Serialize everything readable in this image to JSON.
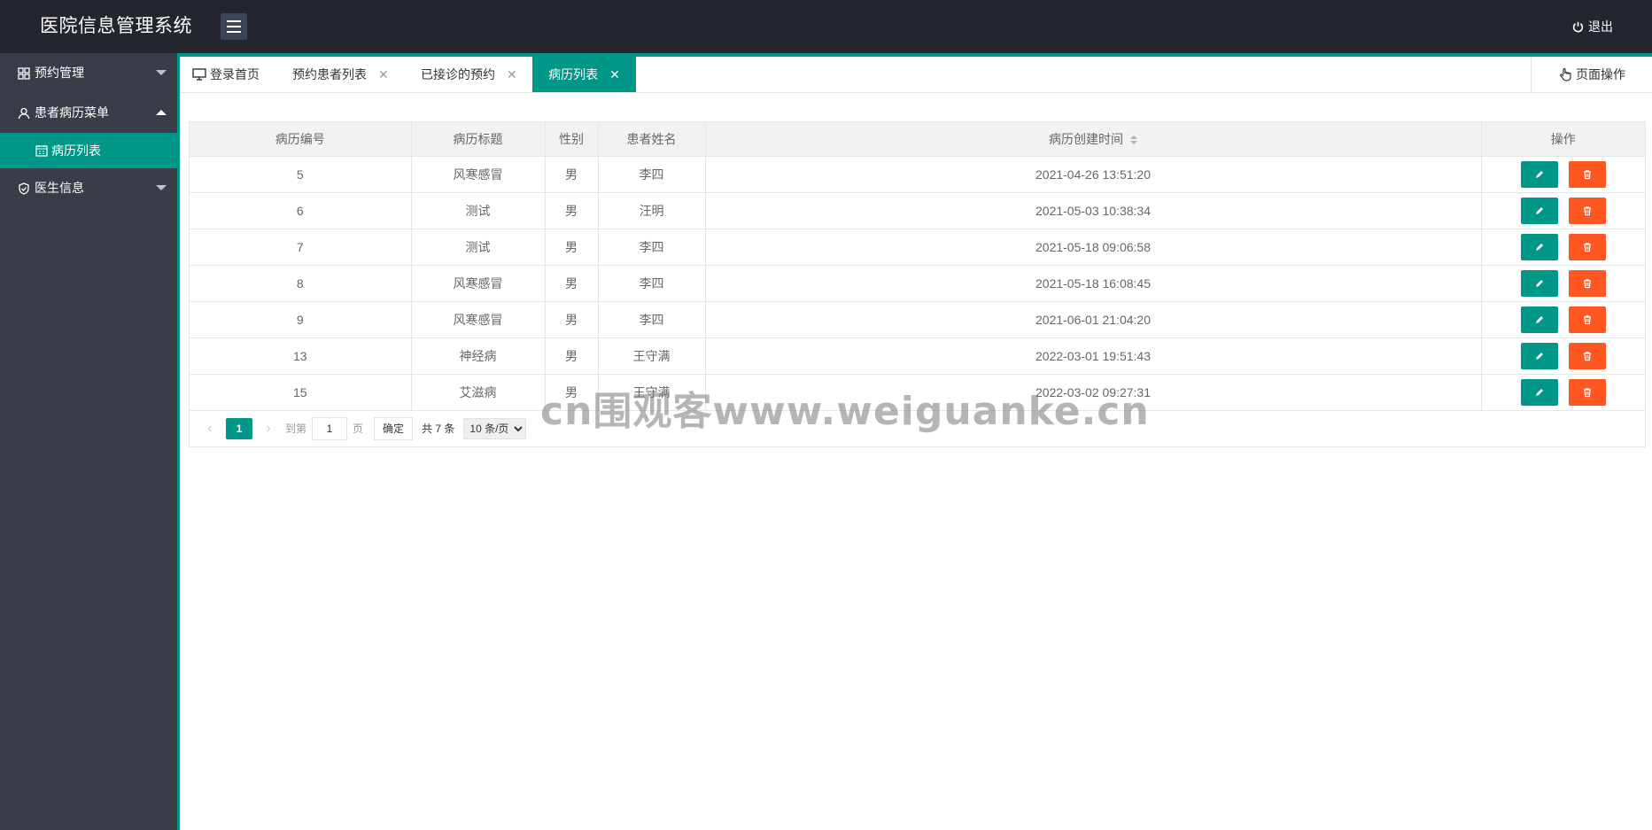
{
  "app": {
    "title": "医院信息管理系统",
    "logout_label": "退出"
  },
  "sidebar": {
    "items": [
      {
        "label": "预约管理"
      },
      {
        "label": "患者病历菜单",
        "children": [
          {
            "label": "病历列表"
          }
        ]
      },
      {
        "label": "医生信息"
      }
    ]
  },
  "tabs": [
    {
      "label": "登录首页"
    },
    {
      "label": "预约患者列表"
    },
    {
      "label": "已接诊的预约"
    },
    {
      "label": "病历列表"
    }
  ],
  "page_ops_label": "页面操作",
  "table": {
    "columns": [
      "病历编号",
      "病历标题",
      "性别",
      "患者姓名",
      "病历创建时间",
      "操作"
    ],
    "rows": [
      [
        "5",
        "风寒感冒",
        "男",
        "李四",
        "2021-04-26 13:51:20"
      ],
      [
        "6",
        "测试",
        "男",
        "汪明",
        "2021-05-03 10:38:34"
      ],
      [
        "7",
        "测试",
        "男",
        "李四",
        "2021-05-18 09:06:58"
      ],
      [
        "8",
        "风寒感冒",
        "男",
        "李四",
        "2021-05-18 16:08:45"
      ],
      [
        "9",
        "风寒感冒",
        "男",
        "李四",
        "2021-06-01 21:04:20"
      ],
      [
        "13",
        "神经病",
        "男",
        "王守满",
        "2022-03-01 19:51:43"
      ],
      [
        "15",
        "艾滋病",
        "男",
        "王守满",
        "2022-03-02 09:27:31"
      ]
    ]
  },
  "pagination": {
    "current_page": "1",
    "goto_label": "到第",
    "goto_value": "1",
    "page_unit": "页",
    "confirm_label": "确定",
    "total_label": "共 7 条",
    "page_size": "10 条/页"
  },
  "watermark": "cn围观客www.weiguanke.cn",
  "colors": {
    "header": "#23262e",
    "sidebar": "#393d49",
    "accent": "#009688",
    "danger": "#ff5722"
  }
}
